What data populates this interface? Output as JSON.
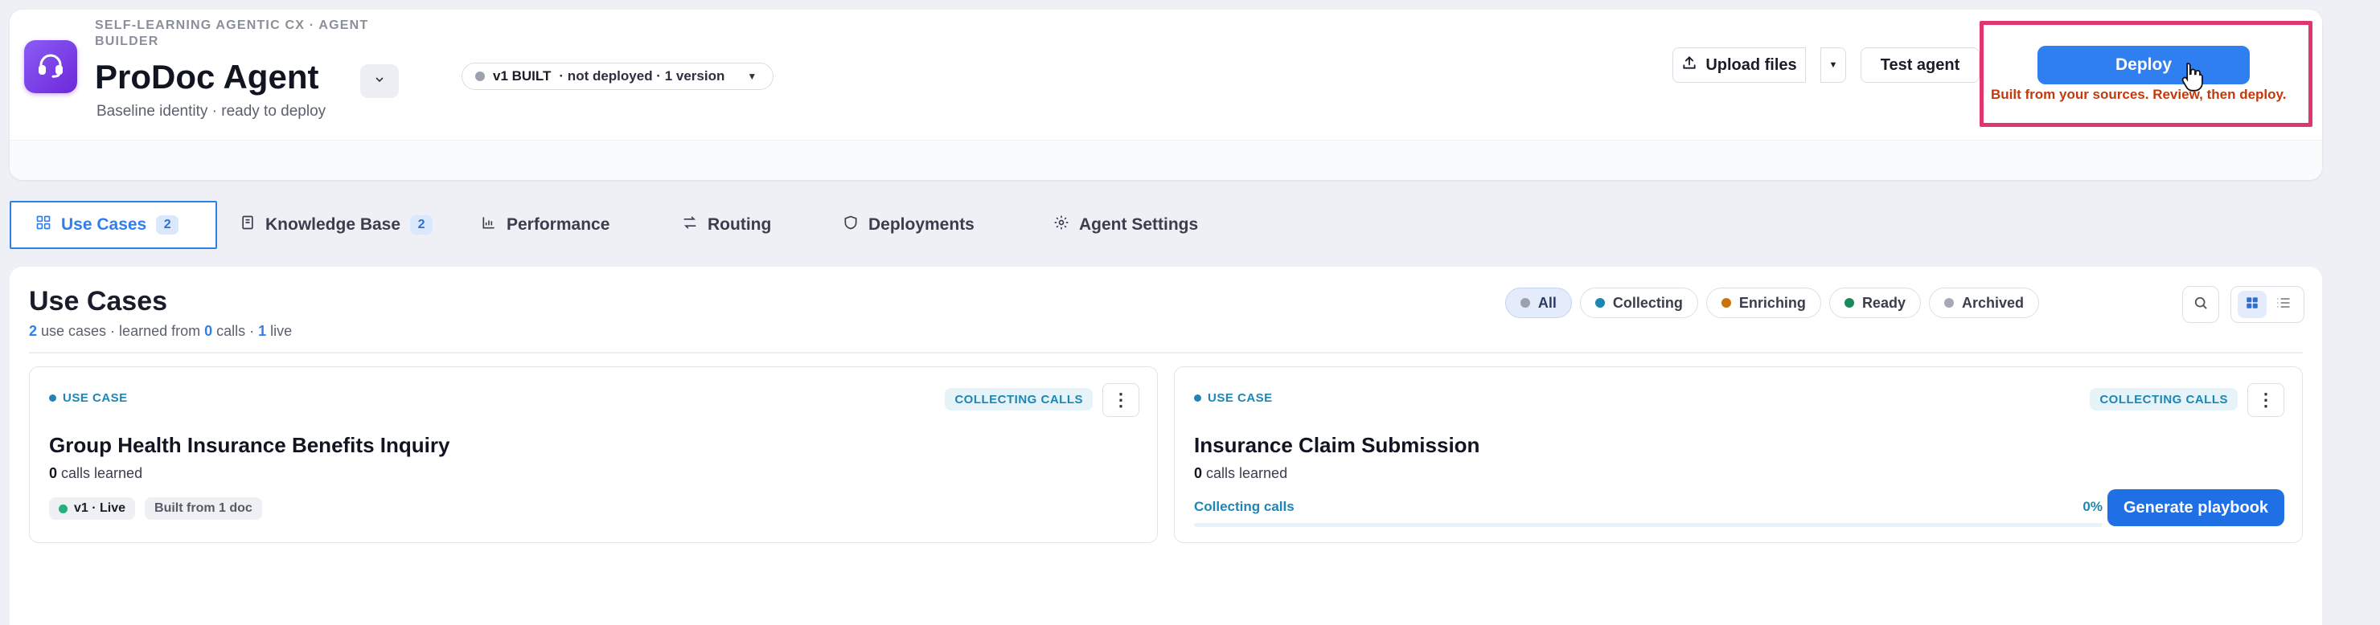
{
  "header": {
    "eyebrow": "SELF-LEARNING AGENTIC CX · AGENT BUILDER",
    "title": "ProDoc Agent",
    "subtitle": "Baseline identity · ready to deploy",
    "version": {
      "badge": "v1 BUILT",
      "status": "· not deployed · 1 version"
    },
    "upload_label": "Upload files",
    "test_label": "Test agent",
    "deploy_label": "Deploy",
    "deploy_note": "Built from your sources. Review, then deploy.",
    "colors": {
      "accent": "#2f7ff0",
      "highlight": "#e0366e",
      "brand": "#7c3aed"
    }
  },
  "tabs": [
    {
      "label": "Use Cases",
      "count": "2",
      "icon": "grid-icon"
    },
    {
      "label": "Knowledge Base",
      "count": "2",
      "icon": "book-icon"
    },
    {
      "label": "Performance",
      "icon": "bar-chart-icon"
    },
    {
      "label": "Routing",
      "icon": "route-icon"
    },
    {
      "label": "Deployments",
      "icon": "shield-icon"
    },
    {
      "label": "Agent Settings",
      "icon": "gear-icon"
    }
  ],
  "main": {
    "title": "Use Cases",
    "summary": {
      "use_cases": "2",
      "use_cases_text": " use cases · learned from ",
      "calls": "0",
      "calls_text": " calls · ",
      "live": "1",
      "live_text": " live"
    },
    "filters": [
      {
        "label": "All",
        "color": "#9ca1ad"
      },
      {
        "label": "Collecting",
        "color": "#1d86b5"
      },
      {
        "label": "Enriching",
        "color": "#c9730a"
      },
      {
        "label": "Ready",
        "color": "#188a5e"
      },
      {
        "label": "Archived",
        "color": "#a5a9b3"
      }
    ]
  },
  "cards": [
    {
      "tag": "USE CASE",
      "status": "COLLECTING CALLS",
      "title": "Group Health Insurance Benefits Inquiry",
      "calls": "0",
      "calls_label": " calls learned",
      "chips": [
        "v1 · Live",
        "Built from 1 doc"
      ]
    },
    {
      "tag": "USE CASE",
      "status": "COLLECTING CALLS",
      "title": "Insurance Claim Submission",
      "calls": "0",
      "calls_label": " calls learned",
      "progress_label": "Collecting calls",
      "progress_pct": "0%",
      "progress_value": 0,
      "action": "Generate playbook"
    }
  ]
}
